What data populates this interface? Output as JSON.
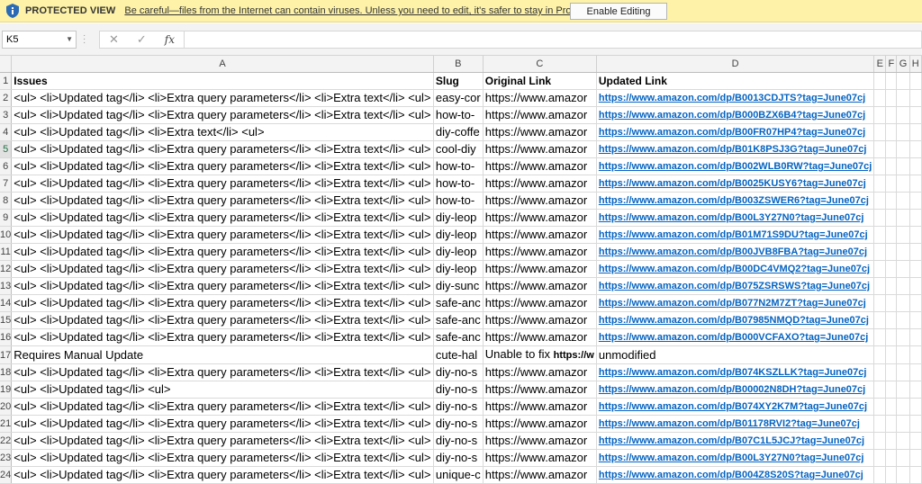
{
  "protected_view": {
    "title": "PROTECTED VIEW",
    "message": "Be careful—files from the Internet can contain viruses. Unless you need to edit, it's safer to stay in Protected View.",
    "button": "Enable Editing"
  },
  "formula_bar": {
    "name_box": "K5",
    "cancel_icon": "✕",
    "enter_icon": "✓",
    "fx_label": "fx",
    "value": ""
  },
  "columns": [
    "A",
    "B",
    "C",
    "D",
    "E",
    "F",
    "G",
    "H"
  ],
  "rows": [
    {
      "n": "1",
      "a": "Issues",
      "b": "Slug",
      "c": "Original Link",
      "d": "Updated Link",
      "header": true
    },
    {
      "n": "2",
      "a": "<ul> <li>Updated tag</li> <li>Extra query parameters</li> <li>Extra text</li> <ul>",
      "b": "easy-cor",
      "c": "https://www.amazor",
      "d": "https://www.amazon.com/dp/B0013CDJTS?tag=June07cj"
    },
    {
      "n": "3",
      "a": "<ul> <li>Updated tag</li> <li>Extra query parameters</li> <li>Extra text</li> <ul>",
      "b": "how-to-",
      "c": "https://www.amazor",
      "d": "https://www.amazon.com/dp/B000BZX6B4?tag=June07cj"
    },
    {
      "n": "4",
      "a": "<ul> <li>Updated tag</li> <li>Extra text</li> <ul>",
      "b": "diy-coffe",
      "c": "https://www.amazor",
      "d": "https://www.amazon.com/dp/B00FR07HP4?tag=June07cj"
    },
    {
      "n": "5",
      "a": "<ul> <li>Updated tag</li> <li>Extra query parameters</li> <li>Extra text</li> <ul>",
      "b": "cool-diy",
      "c": "https://www.amazor",
      "d": "https://www.amazon.com/dp/B01K8PSJ3G?tag=June07cj",
      "active": true
    },
    {
      "n": "6",
      "a": "<ul> <li>Updated tag</li> <li>Extra query parameters</li> <li>Extra text</li> <ul>",
      "b": "how-to-",
      "c": "https://www.amazor",
      "d": "https://www.amazon.com/dp/B002WLB0RW?tag=June07cj"
    },
    {
      "n": "7",
      "a": "<ul> <li>Updated tag</li> <li>Extra query parameters</li> <li>Extra text</li> <ul>",
      "b": "how-to-",
      "c": "https://www.amazor",
      "d": "https://www.amazon.com/dp/B0025KUSY6?tag=June07cj"
    },
    {
      "n": "8",
      "a": "<ul> <li>Updated tag</li> <li>Extra query parameters</li> <li>Extra text</li> <ul>",
      "b": "how-to-",
      "c": "https://www.amazor",
      "d": "https://www.amazon.com/dp/B003ZSWER6?tag=June07cj"
    },
    {
      "n": "9",
      "a": "<ul> <li>Updated tag</li> <li>Extra query parameters</li> <li>Extra text</li> <ul>",
      "b": "diy-leop",
      "c": "https://www.amazor",
      "d": "https://www.amazon.com/dp/B00L3Y27N0?tag=June07cj"
    },
    {
      "n": "10",
      "a": "<ul> <li>Updated tag</li> <li>Extra query parameters</li> <li>Extra text</li> <ul>",
      "b": "diy-leop",
      "c": "https://www.amazor",
      "d": "https://www.amazon.com/dp/B01M71S9DU?tag=June07cj"
    },
    {
      "n": "11",
      "a": "<ul> <li>Updated tag</li> <li>Extra query parameters</li> <li>Extra text</li> <ul>",
      "b": "diy-leop",
      "c": "https://www.amazor",
      "d": "https://www.amazon.com/dp/B00JVB8FBA?tag=June07cj"
    },
    {
      "n": "12",
      "a": "<ul> <li>Updated tag</li> <li>Extra query parameters</li> <li>Extra text</li> <ul>",
      "b": "diy-leop",
      "c": "https://www.amazor",
      "d": "https://www.amazon.com/dp/B00DC4VMQ2?tag=June07cj"
    },
    {
      "n": "13",
      "a": "<ul> <li>Updated tag</li> <li>Extra query parameters</li> <li>Extra text</li> <ul>",
      "b": "diy-sunc",
      "c": "https://www.amazor",
      "d": "https://www.amazon.com/dp/B075ZSRSWS?tag=June07cj"
    },
    {
      "n": "14",
      "a": "<ul> <li>Updated tag</li> <li>Extra query parameters</li> <li>Extra text</li> <ul>",
      "b": "safe-anc",
      "c": "https://www.amazor",
      "d": "https://www.amazon.com/dp/B077N2M7ZT?tag=June07cj"
    },
    {
      "n": "15",
      "a": "<ul> <li>Updated tag</li> <li>Extra query parameters</li> <li>Extra text</li> <ul>",
      "b": "safe-anc",
      "c": "https://www.amazor",
      "d": "https://www.amazon.com/dp/B07985NMQD?tag=June07cj"
    },
    {
      "n": "16",
      "a": "<ul> <li>Updated tag</li> <li>Extra query parameters</li> <li>Extra text</li> <ul>",
      "b": "safe-anc",
      "c": "https://www.amazor",
      "d": "https://www.amazon.com/dp/B000VCFAXO?tag=June07cj"
    },
    {
      "n": "17",
      "a": "Requires Manual Update",
      "b": "cute-hal",
      "c": "Unable to fix",
      "c_extra": "https://w",
      "d": "unmodified",
      "plain_d": true
    },
    {
      "n": "18",
      "a": "<ul> <li>Updated tag</li> <li>Extra query parameters</li> <li>Extra text</li> <ul>",
      "b": "diy-no-s",
      "c": "https://www.amazor",
      "d": "https://www.amazon.com/dp/B074KSZLLK?tag=June07cj"
    },
    {
      "n": "19",
      "a": "<ul> <li>Updated tag</li> <ul>",
      "b": "diy-no-s",
      "c": "https://www.amazor",
      "d": "https://www.amazon.com/dp/B00002N8DH?tag=June07cj"
    },
    {
      "n": "20",
      "a": "<ul> <li>Updated tag</li> <li>Extra query parameters</li> <li>Extra text</li> <ul>",
      "b": "diy-no-s",
      "c": "https://www.amazor",
      "d": "https://www.amazon.com/dp/B074XY2K7M?tag=June07cj"
    },
    {
      "n": "21",
      "a": "<ul> <li>Updated tag</li> <li>Extra query parameters</li> <li>Extra text</li> <ul>",
      "b": "diy-no-s",
      "c": "https://www.amazor",
      "d": "https://www.amazon.com/dp/B01178RVI2?tag=June07cj"
    },
    {
      "n": "22",
      "a": "<ul> <li>Updated tag</li> <li>Extra query parameters</li> <li>Extra text</li> <ul>",
      "b": "diy-no-s",
      "c": "https://www.amazor",
      "d": "https://www.amazon.com/dp/B07C1L5JCJ?tag=June07cj"
    },
    {
      "n": "23",
      "a": "<ul> <li>Updated tag</li> <li>Extra query parameters</li> <li>Extra text</li> <ul>",
      "b": "diy-no-s",
      "c": "https://www.amazor",
      "d": "https://www.amazon.com/dp/B00L3Y27N0?tag=June07cj"
    },
    {
      "n": "24",
      "a": "<ul> <li>Updated tag</li> <li>Extra query parameters</li> <li>Extra text</li> <ul>",
      "b": "unique-c",
      "c": "https://www.amazor",
      "d": "https://www.amazon.com/dp/B004Z8S20S?tag=June07cj"
    }
  ]
}
